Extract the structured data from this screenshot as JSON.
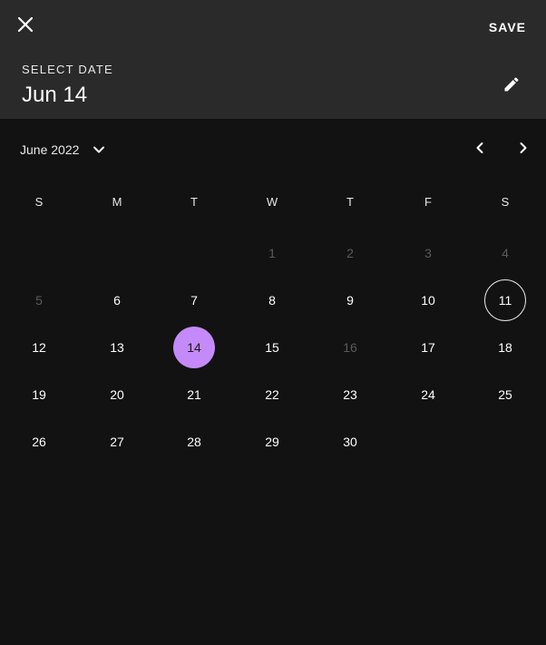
{
  "header": {
    "close_icon": "close-icon",
    "save_label": "SAVE",
    "label": "SELECT DATE",
    "selected_date": "Jun 14",
    "edit_icon": "pencil-icon"
  },
  "month_nav": {
    "label": "June 2022",
    "dropdown_icon": "chevron-down-icon",
    "prev_icon": "chevron-left-icon",
    "next_icon": "chevron-right-icon"
  },
  "weekdays": [
    "S",
    "M",
    "T",
    "W",
    "T",
    "F",
    "S"
  ],
  "days": [
    {
      "label": "1",
      "state": "disabled"
    },
    {
      "label": "2",
      "state": "disabled"
    },
    {
      "label": "3",
      "state": "disabled"
    },
    {
      "label": "4",
      "state": "disabled"
    },
    {
      "label": "5",
      "state": "disabled"
    },
    {
      "label": "6",
      "state": "enabled"
    },
    {
      "label": "7",
      "state": "enabled"
    },
    {
      "label": "8",
      "state": "enabled"
    },
    {
      "label": "9",
      "state": "enabled"
    },
    {
      "label": "10",
      "state": "enabled"
    },
    {
      "label": "11",
      "state": "today"
    },
    {
      "label": "12",
      "state": "enabled"
    },
    {
      "label": "13",
      "state": "enabled"
    },
    {
      "label": "14",
      "state": "selected"
    },
    {
      "label": "15",
      "state": "enabled"
    },
    {
      "label": "16",
      "state": "disabled"
    },
    {
      "label": "17",
      "state": "enabled"
    },
    {
      "label": "18",
      "state": "enabled"
    },
    {
      "label": "19",
      "state": "enabled"
    },
    {
      "label": "20",
      "state": "enabled"
    },
    {
      "label": "21",
      "state": "enabled"
    },
    {
      "label": "22",
      "state": "enabled"
    },
    {
      "label": "23",
      "state": "enabled"
    },
    {
      "label": "24",
      "state": "enabled"
    },
    {
      "label": "25",
      "state": "enabled"
    },
    {
      "label": "26",
      "state": "enabled"
    },
    {
      "label": "27",
      "state": "enabled"
    },
    {
      "label": "28",
      "state": "enabled"
    },
    {
      "label": "29",
      "state": "enabled"
    },
    {
      "label": "30",
      "state": "enabled"
    }
  ],
  "colors": {
    "header_bg": "#2a2a2a",
    "body_bg": "#121212",
    "selected_bg": "#c58af9",
    "disabled_text": "#5a5a5a",
    "text": "#ffffff"
  }
}
